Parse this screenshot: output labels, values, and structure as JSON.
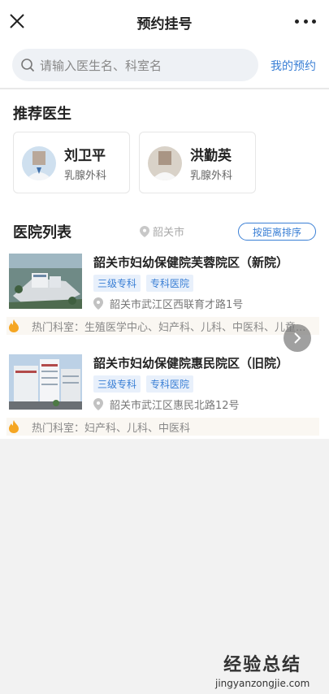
{
  "header": {
    "title": "预约挂号",
    "close_icon": "close-icon",
    "more_icon": "more-dots-icon"
  },
  "search": {
    "placeholder": "请输入医生名、科室名",
    "my_appointments": "我的预约"
  },
  "recommended": {
    "title": "推荐医生",
    "doctors": [
      {
        "name": "刘卫平",
        "dept": "乳腺外科"
      },
      {
        "name": "洪勤英",
        "dept": "乳腺外科"
      }
    ]
  },
  "hospitals": {
    "title": "医院列表",
    "location": "韶关市",
    "sort_label": "按距离排序",
    "items": [
      {
        "name": "韶关市妇幼保健院芙蓉院区（新院）",
        "tags": [
          "三级专科",
          "专科医院"
        ],
        "address": "韶关市武江区西联育才路1号",
        "hot": "热门科室：生殖医学中心、妇产科、儿科、中医科、儿童..."
      },
      {
        "name": "韶关市妇幼保健院惠民院区（旧院）",
        "tags": [
          "三级专科",
          "专科医院"
        ],
        "address": "韶关市武江区惠民北路12号",
        "hot": "热门科室：妇产科、儿科、中医科"
      }
    ]
  },
  "watermark": {
    "cn": "经验总结",
    "en": "jingyanzongjie.com"
  },
  "colors": {
    "accent": "#3a7fd5",
    "tag_bg": "#e8f0fb",
    "hot_icon": "#f5a623"
  }
}
